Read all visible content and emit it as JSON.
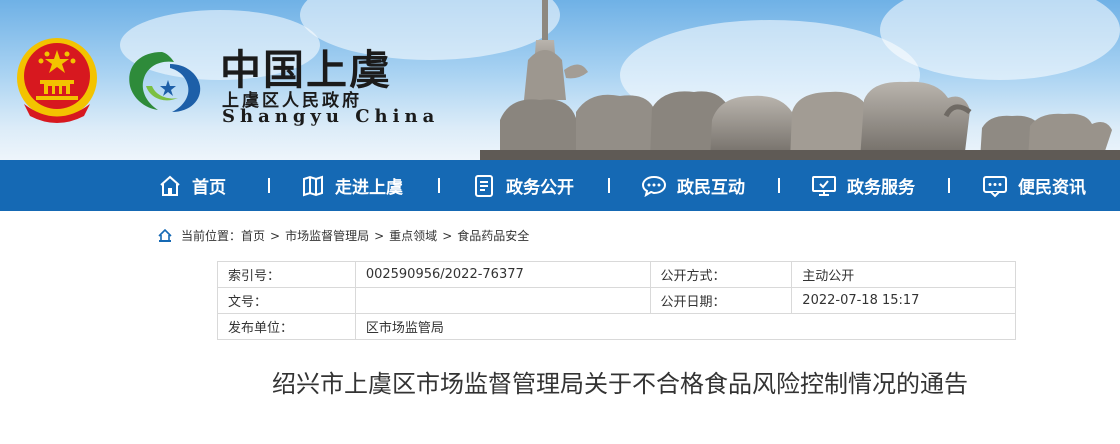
{
  "header": {
    "site_name_cn": "中国上虞",
    "site_sub": "上虞区人民政府",
    "site_en": "Shangyu China"
  },
  "nav": {
    "items": [
      {
        "label": "首页",
        "icon": "home-icon"
      },
      {
        "label": "走进上虞",
        "icon": "map-icon"
      },
      {
        "label": "政务公开",
        "icon": "document-icon"
      },
      {
        "label": "政民互动",
        "icon": "chat-icon"
      },
      {
        "label": "政务服务",
        "icon": "monitor-icon"
      },
      {
        "label": "便民资讯",
        "icon": "message-icon"
      }
    ]
  },
  "breadcrumb": {
    "prefix": "当前位置：",
    "items": [
      "首页",
      "市场监督管理局",
      "重点领域",
      "食品药品安全"
    ],
    "separator": ">"
  },
  "meta": {
    "index_label": "索引号：",
    "index_value": "002590956/2022-76377",
    "method_label": "公开方式：",
    "method_value": "主动公开",
    "doc_no_label": "文号：",
    "doc_no_value": "",
    "date_label": "公开日期：",
    "date_value": "2022-07-18 15:17",
    "publisher_label": "发布单位：",
    "publisher_value": "区市场监管局"
  },
  "article": {
    "title": "绍兴市上虞区市场监督管理局关于不合格食品风险控制情况的通告"
  },
  "colors": {
    "nav_bg": "#1569b4",
    "sky_top": "#6fb1e6",
    "emblem_red": "#d7181f",
    "emblem_gold": "#f3c300",
    "logo_green": "#2e8b3a",
    "logo_blue": "#1d5fa8"
  }
}
